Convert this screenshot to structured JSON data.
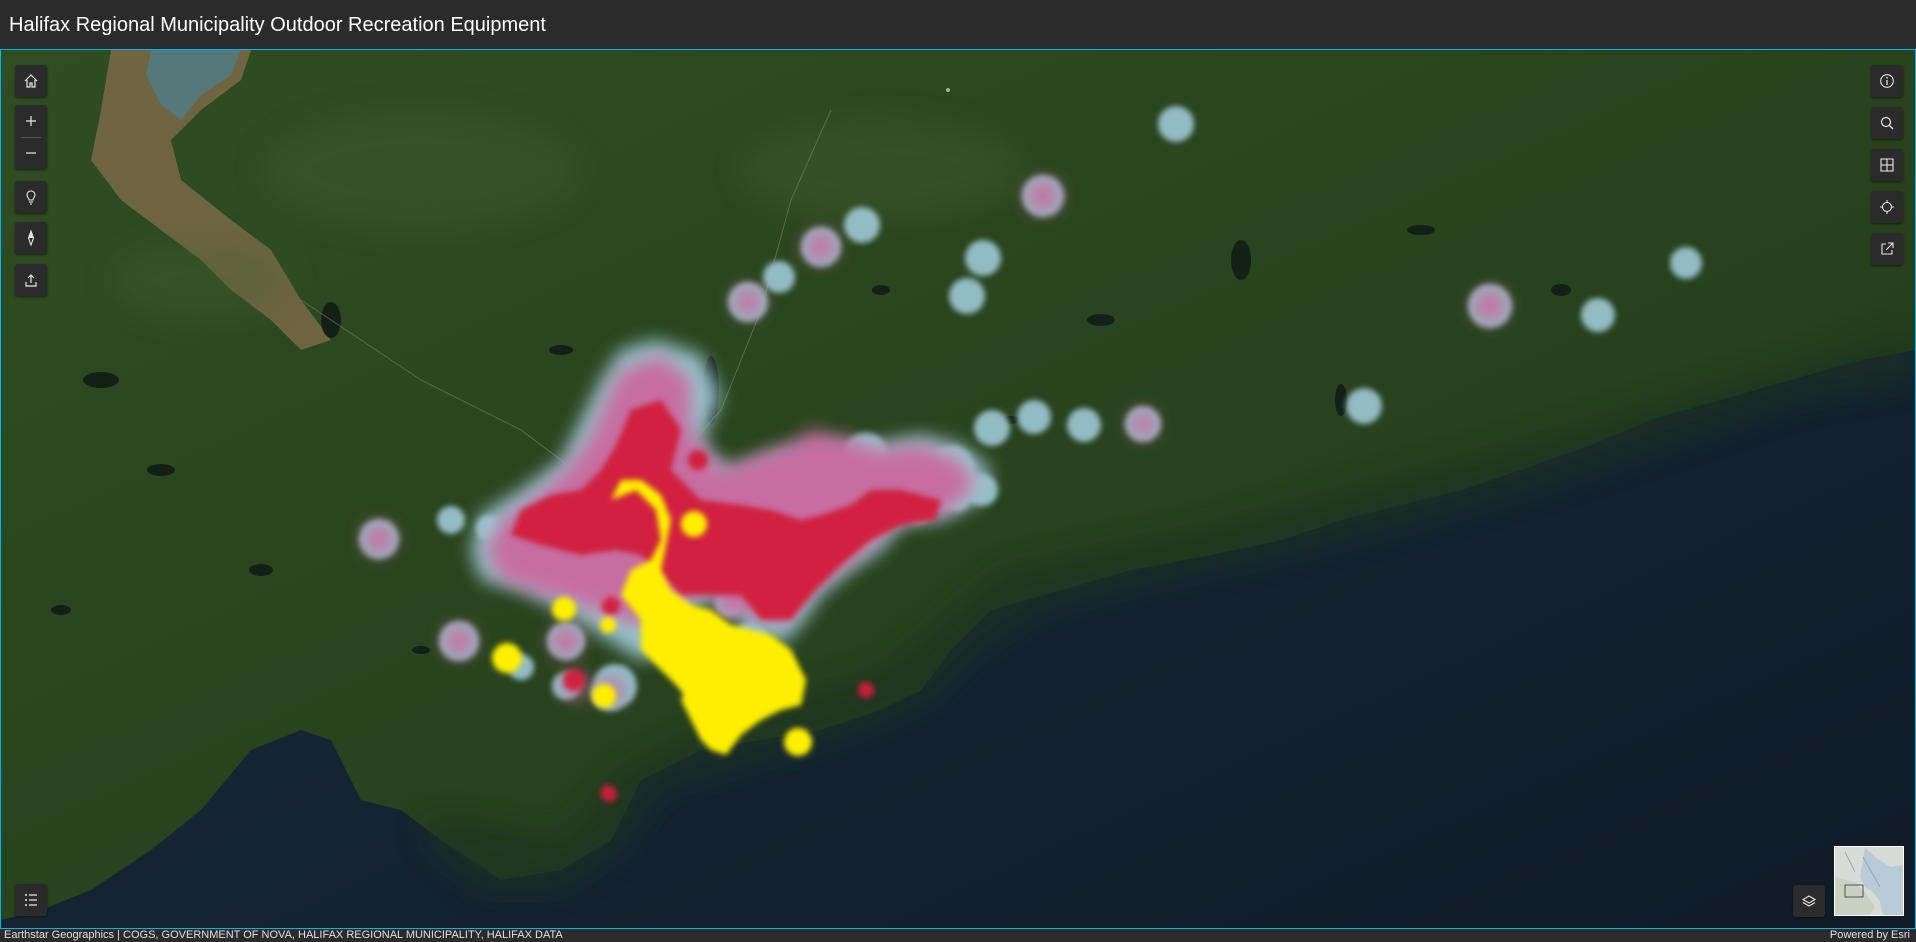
{
  "app": {
    "title": "Halifax Regional Municipality Outdoor Recreation Equipment"
  },
  "map": {
    "basemap": "Imagery (satellite)",
    "layer_style": "heatmap",
    "heat_colors": [
      "#9ec9d6",
      "#c96a9e",
      "#d21a3a",
      "#ffef00"
    ]
  },
  "tools_left": {
    "home": {
      "icon": "home-icon"
    },
    "zoom_in": {
      "icon": "plus-icon"
    },
    "zoom_out": {
      "icon": "minus-icon"
    },
    "tips": {
      "icon": "lightbulb-icon"
    },
    "compass": {
      "icon": "compass-icon"
    },
    "share": {
      "icon": "upload-icon"
    },
    "legend": {
      "icon": "list-icon"
    }
  },
  "tools_right": {
    "info": {
      "icon": "info-icon"
    },
    "search": {
      "icon": "search-icon"
    },
    "basemap_gallery": {
      "icon": "basemap-icon"
    },
    "locate": {
      "icon": "locate-icon"
    },
    "export": {
      "icon": "export-icon"
    },
    "layers": {
      "icon": "layers-icon"
    }
  },
  "footer": {
    "attribution": "Earthstar Geographics | COGS, GOVERNMENT OF NOVA, HALIFAX REGIONAL MUNICIPALITY, HALIFAX DATA",
    "powered_by": "Powered by Esri"
  }
}
